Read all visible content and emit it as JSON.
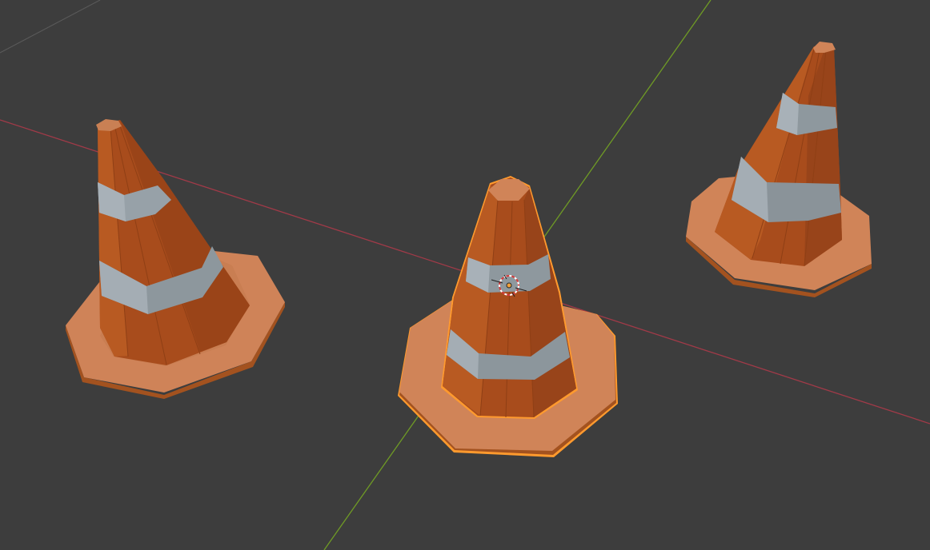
{
  "viewport": {
    "background": "#3d3d3d",
    "view": "perspective-3d-viewport"
  },
  "axes": {
    "x_axis_color": "#a13a48",
    "y_axis_color": "#6f9b25",
    "grid_line_color": "#5a5a5a"
  },
  "objects": [
    {
      "name": "traffic-cone",
      "selected": false
    },
    {
      "name": "traffic-cone",
      "selected": true,
      "active": true
    },
    {
      "name": "traffic-cone",
      "selected": false
    }
  ],
  "colors": {
    "cone_orange_light": "#b9561f",
    "cone_orange_mid": "#a54a1b",
    "cone_orange_dark": "#8a3a12",
    "stripe_light": "#a4adb4",
    "stripe_dark": "#7d878d",
    "base_top": "#d08458",
    "base_side": "#a3521f",
    "selection_outline": "#ff9a2e"
  },
  "overlays": {
    "origin_marker": "object-origin-dot",
    "cursor": "3d-cursor-icon"
  }
}
